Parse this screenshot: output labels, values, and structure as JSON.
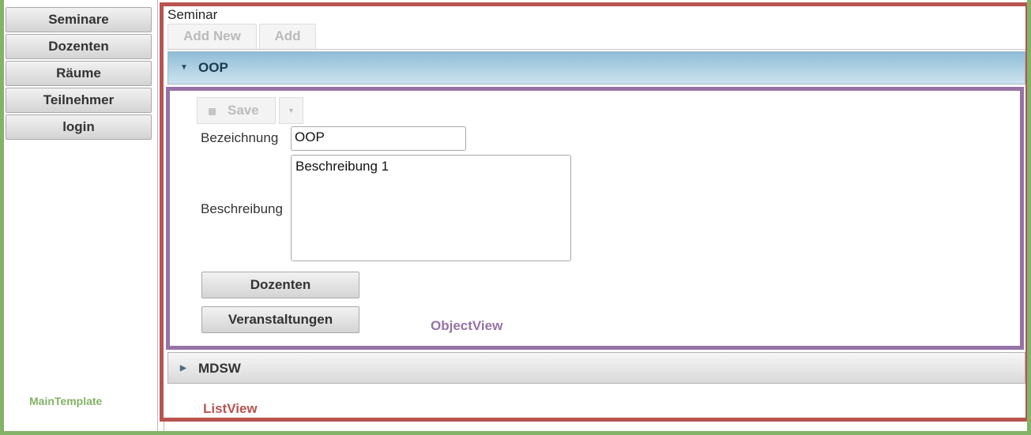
{
  "sidebar": {
    "items": [
      {
        "label": "Seminare"
      },
      {
        "label": "Dozenten"
      },
      {
        "label": "Räume"
      },
      {
        "label": "Teilnehmer"
      },
      {
        "label": "login"
      }
    ]
  },
  "frames": {
    "main_template": "MainTemplate",
    "list_view": "ListView",
    "object_view": "ObjectView"
  },
  "list": {
    "title": "Seminar",
    "tabs": [
      {
        "label": "Add New"
      },
      {
        "label": "Add"
      }
    ],
    "entries": [
      {
        "label": "OOP",
        "expanded": true
      },
      {
        "label": "MDSW",
        "expanded": false
      }
    ]
  },
  "object": {
    "toolbar": {
      "save_label": "Save"
    },
    "fields": {
      "bezeichnung_label": "Bezeichnung",
      "bezeichnung_value": "OOP",
      "beschreibung_label": "Beschreibung",
      "beschreibung_value": "Beschreibung 1"
    },
    "actions": [
      {
        "label": "Dozenten"
      },
      {
        "label": "Veranstaltungen"
      }
    ]
  },
  "colors": {
    "main_template": "#82b366",
    "list_view": "#b85450",
    "object_view": "#9673a6",
    "accordion_active": "#8fbdd6"
  }
}
